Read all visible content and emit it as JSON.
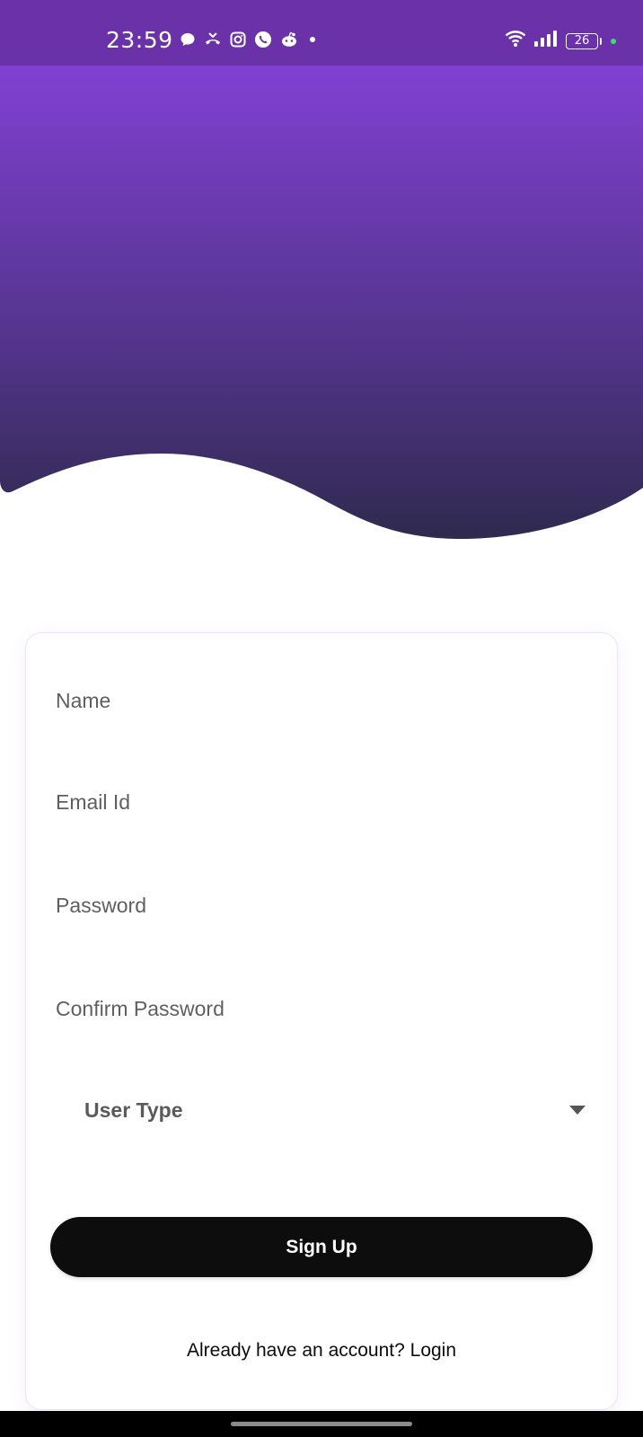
{
  "status_bar": {
    "time": "23:59",
    "battery_level": "26",
    "left_icons": [
      "chat-bubble-icon",
      "missed-call-icon",
      "instagram-icon",
      "viber-icon",
      "reddit-icon",
      "more-dot-icon"
    ],
    "right_icons": [
      "wifi-icon",
      "signal-icon",
      "battery-icon",
      "dot-indicator-icon"
    ]
  },
  "colors": {
    "status_bar": "#6a31a8",
    "header_top": "#8140d2",
    "header_bottom": "#2f2a4f",
    "button_bg": "#0d0d0d",
    "card_border": "#efe2f4"
  },
  "form": {
    "name_placeholder": "Name",
    "email_placeholder": "Email Id",
    "password_placeholder": "Password",
    "confirm_password_placeholder": "Confirm Password",
    "user_type_label": "User Type",
    "signup_label": "Sign Up",
    "login_prompt": "Already have an account? Login"
  }
}
